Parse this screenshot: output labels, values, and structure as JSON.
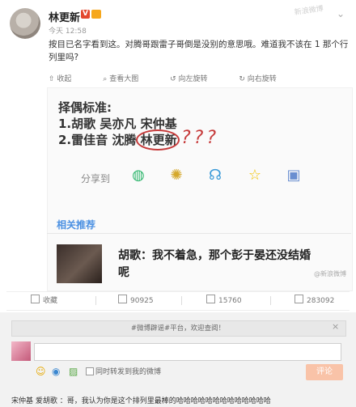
{
  "post": {
    "username": "林更新",
    "v_badge": "V",
    "timestamp": "今天 12:58",
    "text": "按目已名字看到这。对腾哥跟雷子哥倒是没别的意思哦。难道我不该在 1 那个行列里吗?",
    "watermark": "新浪微博"
  },
  "action_bar": [
    "收起",
    "查看大图",
    "向左旋转",
    "向右旋转"
  ],
  "embedded": {
    "title": "择偶标准:",
    "line1": "1.胡歌 吴亦凡 宋仲基",
    "line2": "2.雷佳音 沈腾 林更新",
    "question_marks": "???",
    "share_label": "分享到",
    "related_label": "相关推荐",
    "related_text": "胡歌：我不着急，那个彭于晏还没结婚呢",
    "related_watermark": "@新浪微博"
  },
  "stats": {
    "collect": "收藏",
    "repost": "90925",
    "comment": "15760",
    "like": "283092"
  },
  "comment_panel": {
    "notice": "#微博辟谣#平台，欢迎查阅！",
    "checkbox_label": "同时转发到我的微博",
    "post_button": "评论"
  },
  "next_comment": "宋仲基 爱胡歌 ：哥，我认为你是这个排列里最棒的哈哈哈哈哈哈哈哈哈哈哈哈哈"
}
